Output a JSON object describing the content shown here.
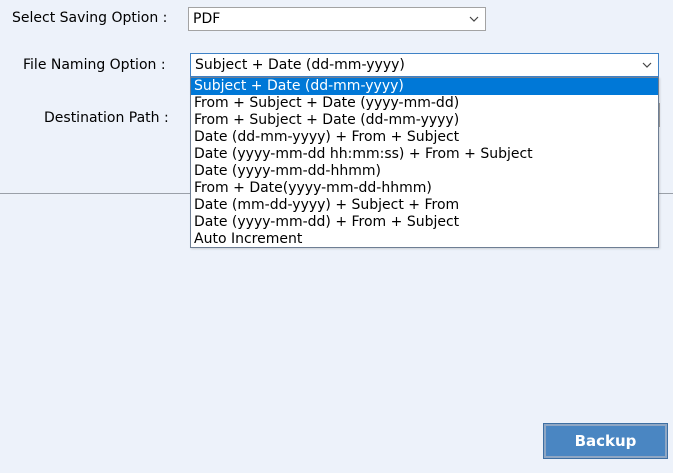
{
  "saving_option": {
    "label": "Select Saving Option :",
    "value": "PDF"
  },
  "file_naming": {
    "label": "File Naming Option :",
    "value": "Subject + Date (dd-mm-yyyy)",
    "options": [
      "Subject + Date (dd-mm-yyyy)",
      "From + Subject + Date (yyyy-mm-dd)",
      "From + Subject + Date (dd-mm-yyyy)",
      "Date (dd-mm-yyyy) + From + Subject",
      "Date (yyyy-mm-dd hh:mm:ss) + From + Subject",
      "Date (yyyy-mm-dd-hhmm)",
      "From + Date(yyyy-mm-dd-hhmm)",
      "Date (mm-dd-yyyy) + Subject + From",
      "Date (yyyy-mm-dd) + From + Subject",
      "Auto Increment"
    ],
    "selected_index": 0
  },
  "destination": {
    "label": "Destination Path :"
  },
  "actions": {
    "backup_label": "Backup"
  },
  "icons": {
    "dropdown_arrow": "chevron-down-icon"
  },
  "colors": {
    "background": "#edf2fa",
    "selection": "#0078d7",
    "button": "#4a86c2"
  }
}
